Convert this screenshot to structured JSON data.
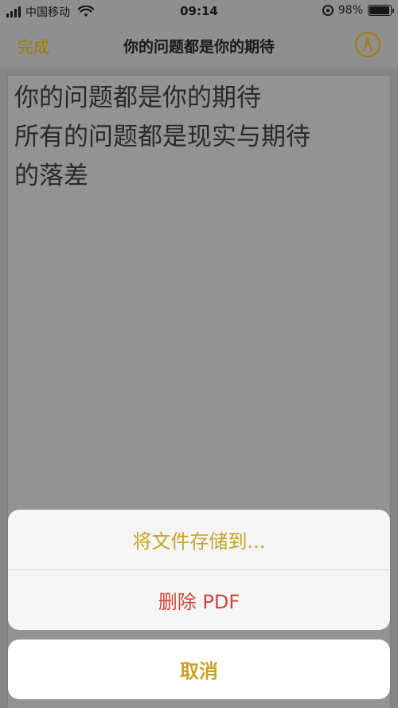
{
  "status_bar": {
    "carrier": "中国移动",
    "time": "09:14",
    "battery": "98%",
    "battery_level": 0.98
  },
  "nav": {
    "done_label": "完成",
    "title": "你的问题都是你的期待",
    "markup_icon": "markup-pen-icon"
  },
  "document": {
    "lines": [
      "你的问题都是你的期待",
      "所有的问题都是现实与期待",
      "的落差"
    ]
  },
  "action_sheet": {
    "save_label": "将文件存储到...",
    "delete_label": "删除 PDF",
    "cancel_label": "取消"
  },
  "colors": {
    "accent": "#c9a227",
    "destructive": "#d0463c"
  }
}
